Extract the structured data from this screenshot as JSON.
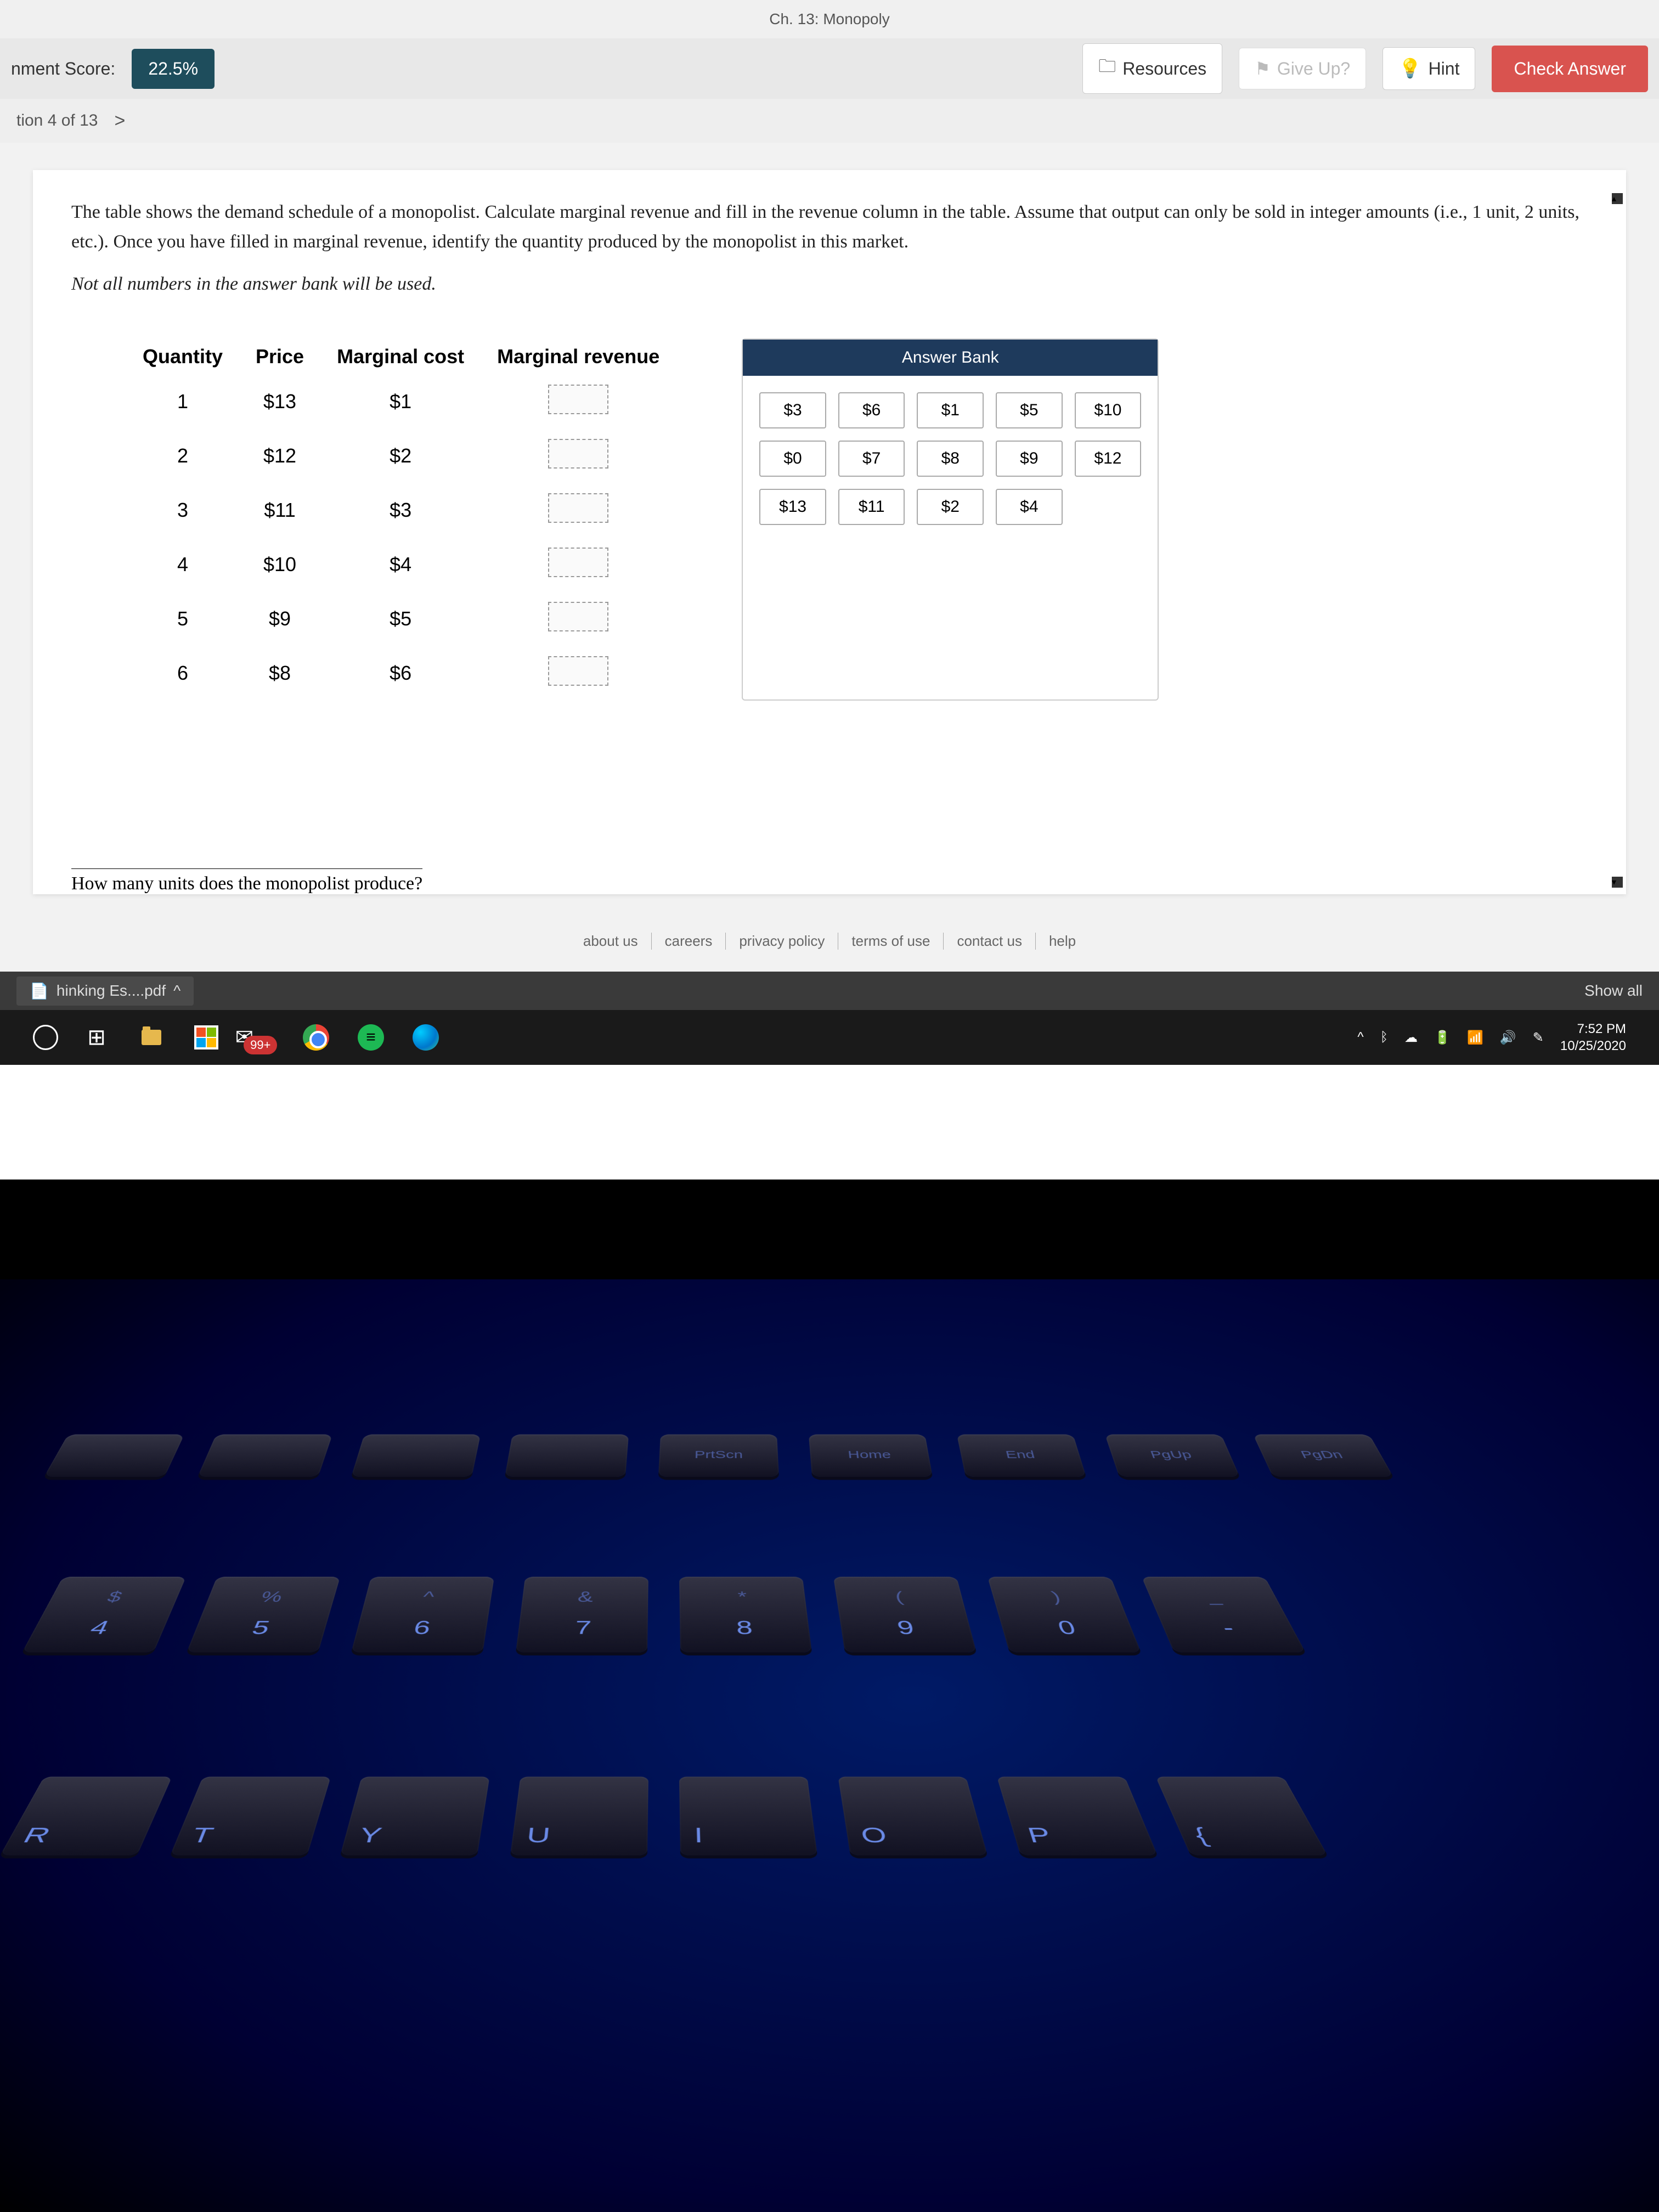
{
  "browser_tab_hint": "Ch. 13: Monopoly",
  "header": {
    "score_label": "nment Score:",
    "score_value": "22.5%",
    "resources": "Resources",
    "give_up": "Give Up?",
    "hint": "Hint",
    "check": "Check Answer"
  },
  "subbar": {
    "question_label": "tion 4 of 13",
    "chevron": ">"
  },
  "prompt": {
    "p1": "The table shows the demand schedule of a monopolist. Calculate marginal revenue and fill in the revenue column in the table. Assume that output can only be sold in integer amounts (i.e., 1 unit, 2 units, etc.). Once you have filled in marginal revenue, identify the quantity produced by the monopolist in this market.",
    "note": "Not all numbers in the answer bank will be used."
  },
  "table": {
    "headers": [
      "Quantity",
      "Price",
      "Marginal cost",
      "Marginal revenue"
    ],
    "rows": [
      {
        "q": "1",
        "p": "$13",
        "mc": "$1"
      },
      {
        "q": "2",
        "p": "$12",
        "mc": "$2"
      },
      {
        "q": "3",
        "p": "$11",
        "mc": "$3"
      },
      {
        "q": "4",
        "p": "$10",
        "mc": "$4"
      },
      {
        "q": "5",
        "p": "$9",
        "mc": "$5"
      },
      {
        "q": "6",
        "p": "$8",
        "mc": "$6"
      }
    ]
  },
  "answer_bank": {
    "title": "Answer Bank",
    "chips": [
      "$3",
      "$6",
      "$1",
      "$5",
      "$10",
      "$0",
      "$7",
      "$8",
      "$9",
      "$12",
      "$13",
      "$11",
      "$2",
      "$4"
    ]
  },
  "cutoff_question": "How many units does the monopolist produce?",
  "footer_links": [
    "about us",
    "careers",
    "privacy policy",
    "terms of use",
    "contact us",
    "help"
  ],
  "download_bar": {
    "file": "hinking Es....pdf",
    "chev": "^",
    "show_all": "Show all"
  },
  "taskbar": {
    "badge": "99+",
    "time": "7:52 PM",
    "date": "10/25/2020"
  },
  "keyboard": {
    "fn": [
      "",
      "",
      "",
      "",
      "PrtScn",
      "Home",
      "End",
      "PgUp",
      "PgDn"
    ],
    "num": [
      {
        "sym": "$",
        "n": "4"
      },
      {
        "sym": "%",
        "n": "5"
      },
      {
        "sym": "^",
        "n": "6"
      },
      {
        "sym": "&",
        "n": "7"
      },
      {
        "sym": "*",
        "n": "8"
      },
      {
        "sym": "(",
        "n": "9"
      },
      {
        "sym": ")",
        "n": "0"
      },
      {
        "sym": "_",
        "n": "-"
      }
    ],
    "alpha": [
      "R",
      "T",
      "Y",
      "U",
      "I",
      "O",
      "P",
      "{"
    ]
  }
}
